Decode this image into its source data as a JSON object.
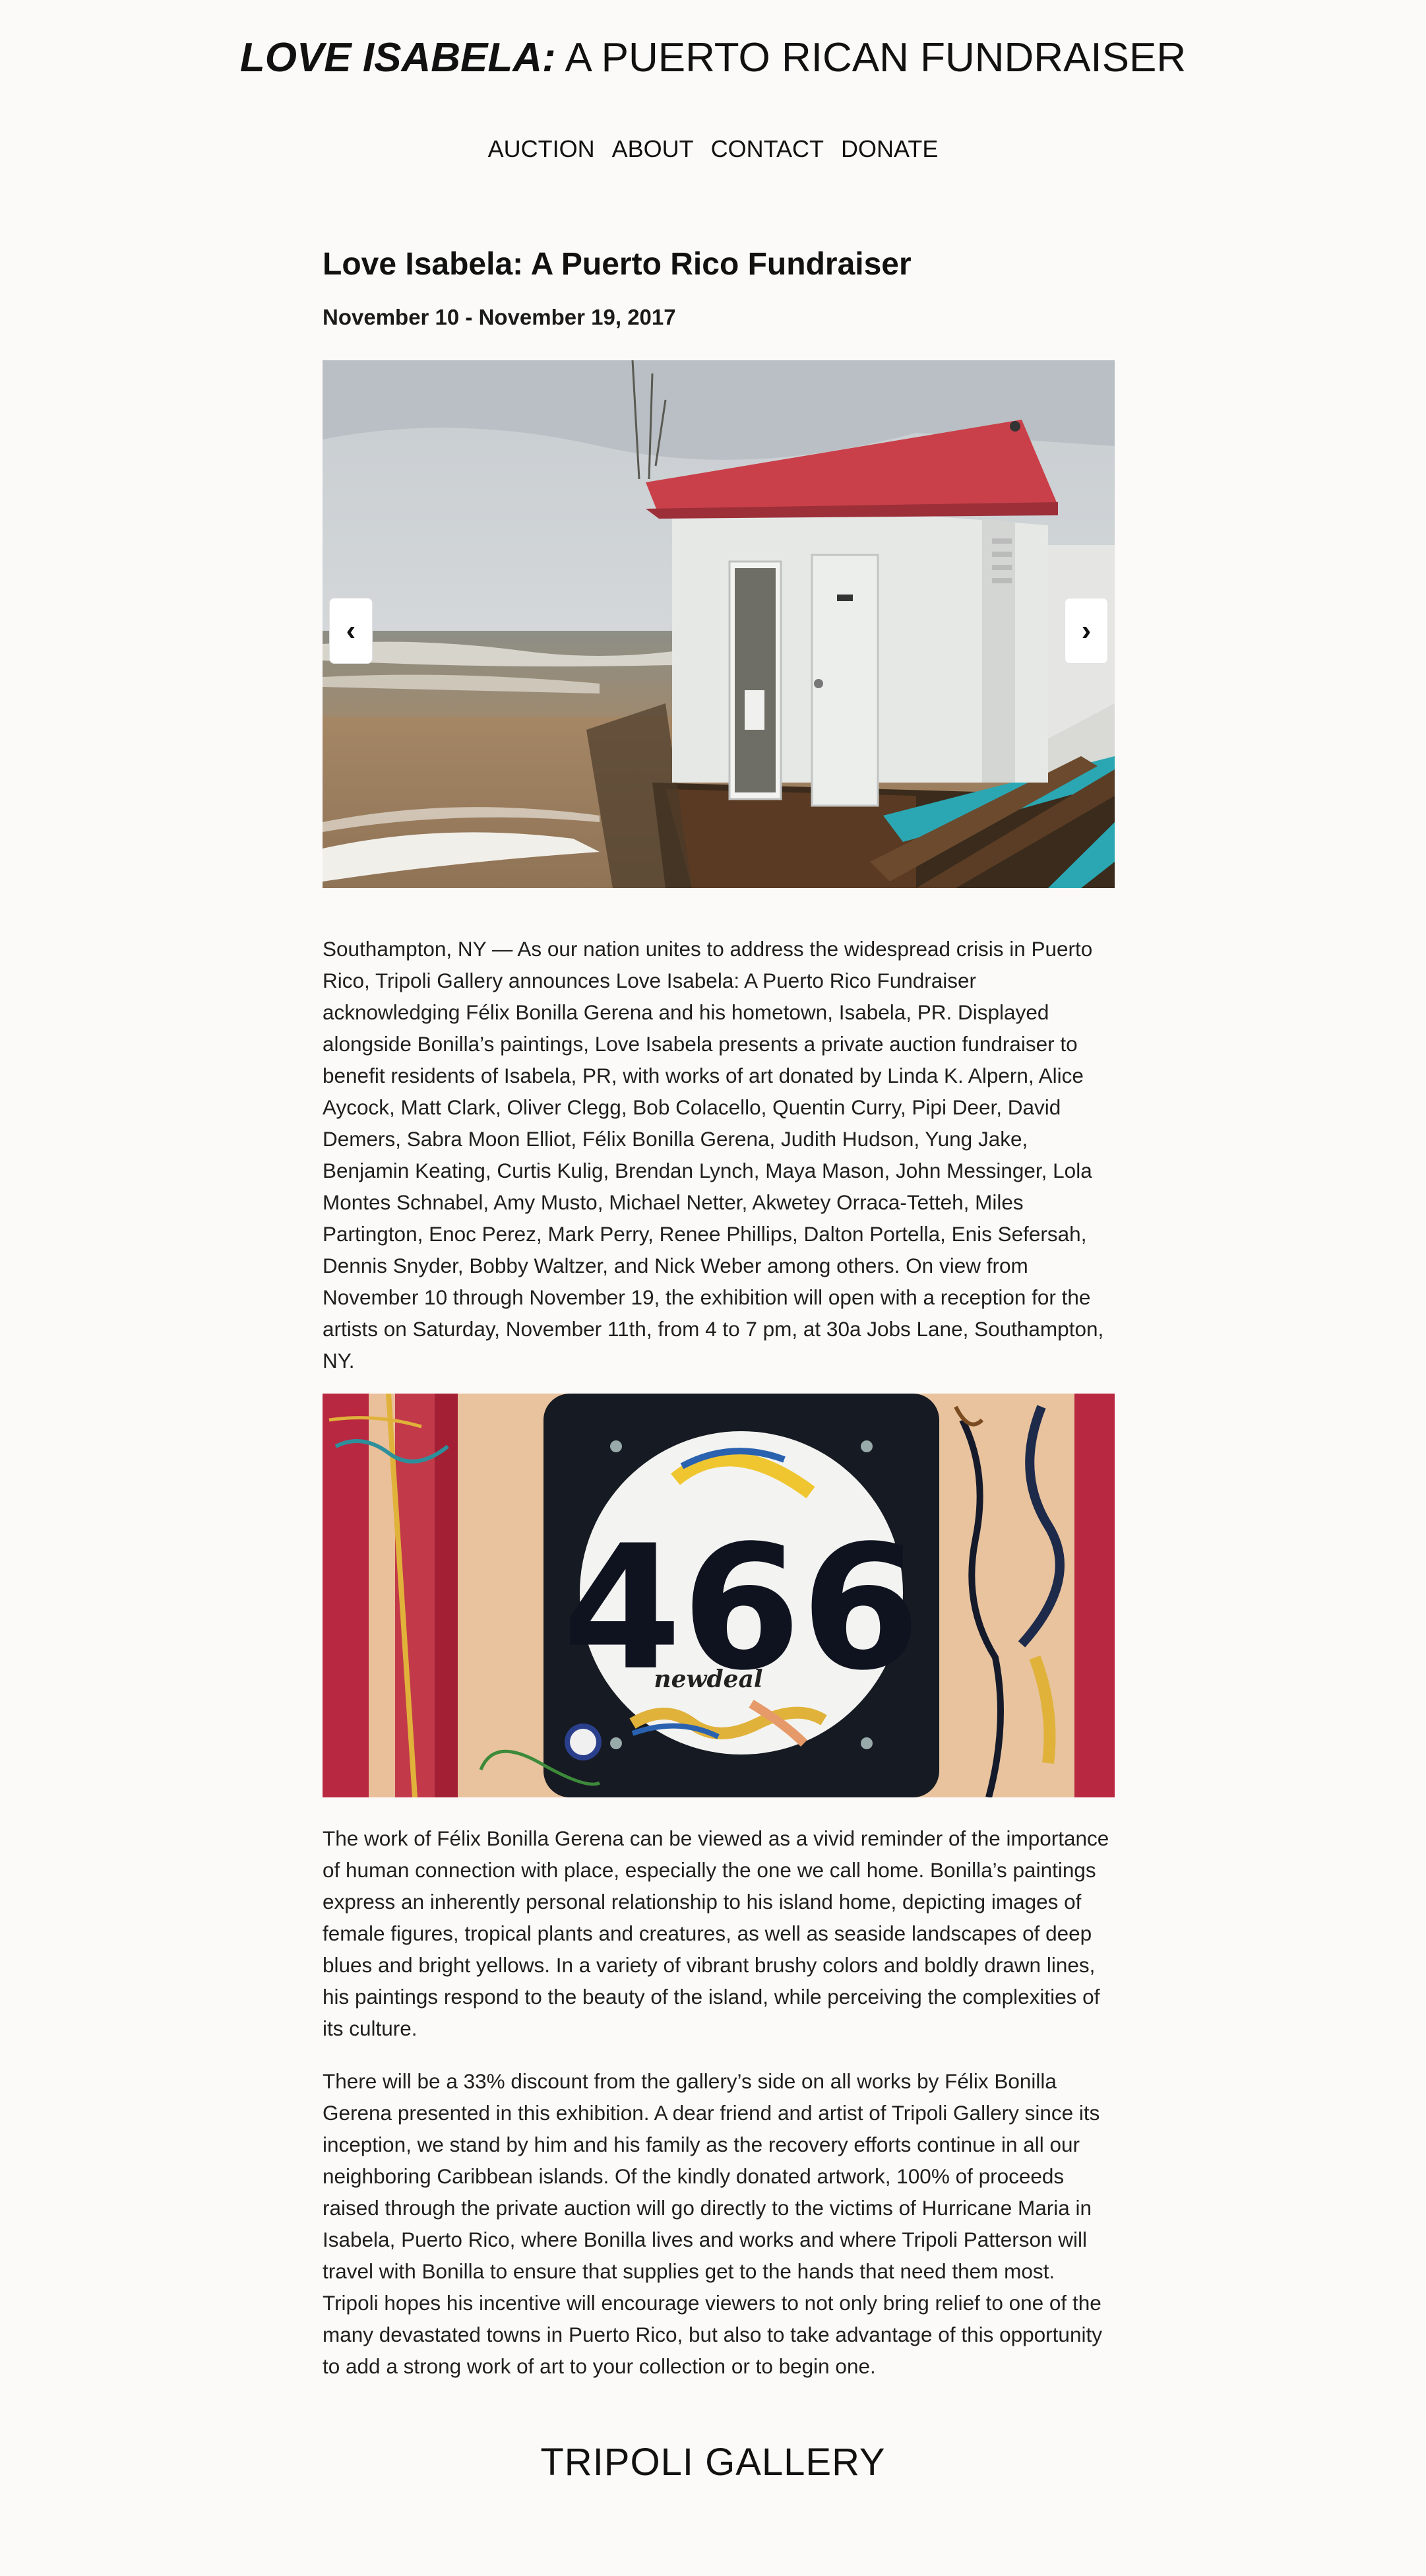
{
  "header": {
    "title_strong": "LOVE ISABELA:",
    "title_light": " A PUERTO RICAN FUNDRAISER"
  },
  "nav": {
    "items": [
      {
        "label": "AUCTION"
      },
      {
        "label": "ABOUT"
      },
      {
        "label": "CONTACT"
      },
      {
        "label": "DONATE"
      }
    ]
  },
  "article": {
    "title": "Love Isabela: A Puerto Rico Fundraiser",
    "dates": "November 10 - November 19, 2017",
    "slider": {
      "prev_label": "‹",
      "next_label": "›"
    },
    "paragraph_1": "Southampton, NY — As our nation unites to address the widespread crisis in Puerto Rico, Tripoli Gallery announces Love Isabela: A Puerto Rico Fundraiser acknowledging Félix Bonilla Gerena and his hometown, Isabela, PR. Displayed alongside Bonilla’s paintings, Love Isabela presents a private auction fundraiser to benefit residents of Isabela, PR, with works of art donated by Linda K. Alpern, Alice Aycock, Matt Clark, Oliver Clegg, Bob Colacello, Quentin Curry, Pipi Deer, David Demers, Sabra Moon Elliot, Félix Bonilla Gerena, Judith Hudson, Yung Jake, Benjamin Keating, Curtis Kulig, Brendan Lynch, Maya Mason, John Messinger, Lola Montes Schnabel, Amy Musto, Michael Netter, Akwetey Orraca-Tetteh, Miles Partington, Enoc Perez, Mark Perry, Renee Phillips, Dalton Portella, Enis Sefersah, Dennis Snyder, Bobby Waltzer, and Nick Weber among others. On view from November 10 through November 19, the exhibition will open with a reception for the artists on Saturday, November 11th, from 4 to 7 pm, at 30a Jobs Lane, Southampton, NY.",
    "sign_number": "466",
    "sign_sticker": "newdeal",
    "paragraph_2": "The work of Félix Bonilla Gerena can be viewed as a vivid reminder of the importance of human connection with place, especially the one we call home. Bonilla’s paintings express an inherently personal relationship to his island home, depicting images of female figures, tropical plants and creatures, as well as seaside landscapes of deep blues and bright yellows. In a variety of vibrant brushy colors and boldly drawn lines, his paintings respond to the beauty of the island, while perceiving the complexities of its culture.",
    "paragraph_3": "There will be a 33% discount from the gallery’s side on all works by Félix Bonilla Gerena presented in this exhibition. A dear friend and artist of Tripoli Gallery since its inception, we stand by him and his family as the recovery efforts continue in all our neighboring Caribbean islands. Of the kindly donated artwork, 100% of proceeds raised through the private auction will go directly to the victims of Hurricane Maria in Isabela, Puerto Rico, where Bonilla lives and works and where Tripoli Patterson will travel with Bonilla to ensure that supplies get to the hands that need them most. Tripoli hopes his incentive will encourage viewers to not only bring relief to one of the many devastated towns in Puerto Rico, but also to take advantage of this opportunity to add a strong work of art to your collection or to begin one."
  },
  "footer": {
    "logo": "TRIPOLI GALLERY"
  },
  "colors": {
    "background": "#fbfaf8",
    "text": "#1a1a1a",
    "roof_red": "#c9404a",
    "teal": "#2aa7b2"
  }
}
